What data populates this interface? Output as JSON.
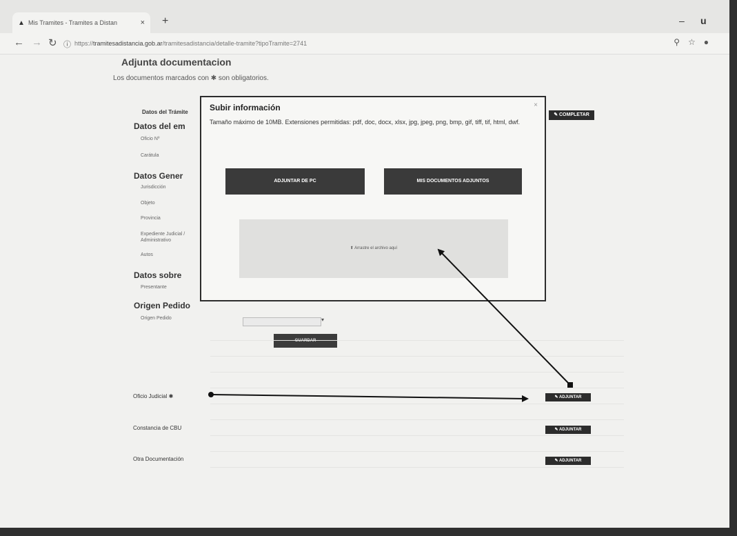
{
  "browser": {
    "tab_title": "Mis Tramites - Tramites a Distan",
    "tab_close": "×",
    "new_tab": "+",
    "url_prefix": "https://",
    "url_host": "tramitesadistancia.gob.ar",
    "url_rest": "/tramitesadistancia/detalle-tramite?tipoTramite=2741",
    "icons": {
      "back": "back-arrow-icon",
      "forward": "forward-arrow-icon",
      "reload": "reload-icon",
      "info": "info-icon",
      "zoom": "zoom-icon",
      "bookmark": "star-icon",
      "account": "account-icon"
    },
    "window_min": "–",
    "window_max": "u"
  },
  "page": {
    "heading": "Adjunta documentacion",
    "subheading": "Los documentos marcados con ✱ son obligatorios."
  },
  "form": {
    "header_label": "Datos del Trámite",
    "complete_label": "✎ COMPLETAR",
    "section_1": {
      "title": "Datos del em",
      "fields": [
        "Oficio Nº",
        "Carátula"
      ]
    },
    "section_2": {
      "title": "Datos Gener",
      "fields": [
        "Jurisdicción",
        "Objeto",
        "Provincia",
        "Expediente Judicial / Administrativo",
        "Autos"
      ]
    },
    "section_3": {
      "title": "Datos sobre",
      "fields": [
        "Presentante"
      ]
    },
    "section_4": {
      "title": "Origen Pedido",
      "fields": [
        "Origen Pedido"
      ]
    },
    "save_label": "GUARDAR"
  },
  "documents": [
    {
      "label": "Oficio Judicial ✱",
      "button": "✎ ADJUNTAR"
    },
    {
      "label": "Constancia de CBU",
      "button": "✎ ADJUNTAR"
    },
    {
      "label": "Otra Documentación",
      "button": "✎ ADJUNTAR"
    }
  ],
  "modal": {
    "title": "Subir información",
    "close": "×",
    "description": "Tamaño máximo de 10MB. Extensiones permitidas: pdf, doc, docx, xlsx, jpg, jpeg, png, bmp, gif, tiff, tif, html, dwf.",
    "btn_pc": "ADJUNTAR DE PC",
    "btn_docs": "MIS DOCUMENTOS ADJUNTOS",
    "dropzone": "⬆ Arrastre el archivo aquí"
  },
  "colors": {
    "dark_button": "#2c2c2c",
    "page_bg": "#f1f1ef",
    "dropzone": "#e0e0de"
  }
}
